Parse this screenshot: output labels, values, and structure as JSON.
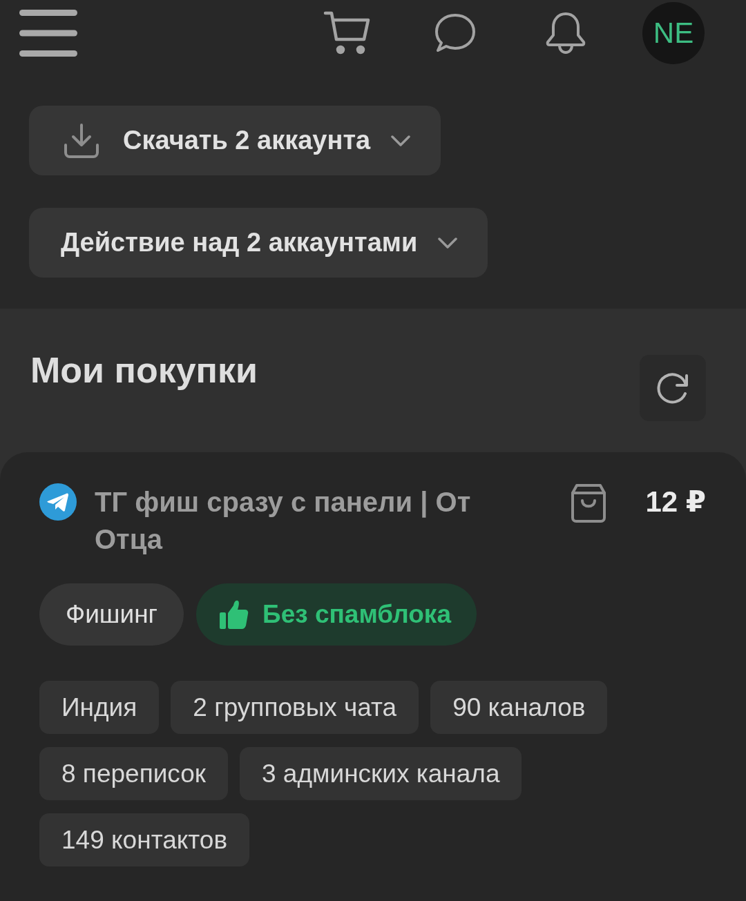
{
  "header": {
    "avatar": {
      "initials": "NE"
    }
  },
  "actions": [
    {
      "kind": "download",
      "label": "Скачать 2 аккаунта"
    },
    {
      "kind": "plain",
      "label": "Действие над 2 аккаунтами"
    }
  ],
  "purchases": {
    "title": "Мои покупки",
    "items": [
      {
        "title": "ТГ фиш сразу с панели | От Отца",
        "price": "12 ₽",
        "badges": [
          {
            "kind": "category",
            "label": "Фишинг"
          },
          {
            "kind": "positive",
            "label": "Без спамблока"
          }
        ],
        "tags": [
          "Индия",
          "2 групповых чата",
          "90 каналов",
          "8 переписок",
          "3 админских канала",
          "149 контактов"
        ]
      }
    ]
  }
}
